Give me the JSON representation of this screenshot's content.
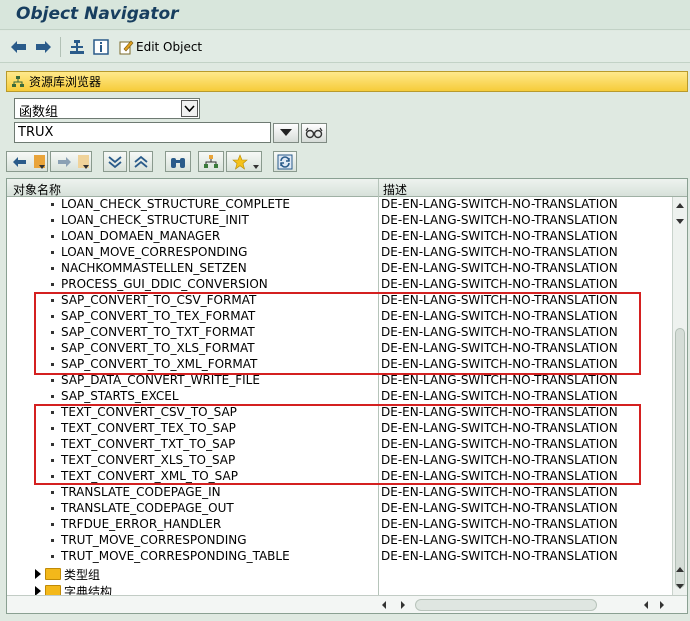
{
  "window": {
    "title": "Object Navigator"
  },
  "toolbar": {
    "edit_object_label": "Edit Object"
  },
  "repository_browser": {
    "panel_label": "资源库浏览器",
    "object_type_selected": "函数组",
    "object_name_value": "TRUX"
  },
  "tree": {
    "col_object_name": "对象名称",
    "col_description": "描述",
    "rows": [
      {
        "name": "LOAN_CHECK_STRUCTURE_COMPLETE",
        "desc": "DE-EN-LANG-SWITCH-NO-TRANSLATION"
      },
      {
        "name": "LOAN_CHECK_STRUCTURE_INIT",
        "desc": "DE-EN-LANG-SWITCH-NO-TRANSLATION"
      },
      {
        "name": "LOAN_DOMAEN_MANAGER",
        "desc": "DE-EN-LANG-SWITCH-NO-TRANSLATION"
      },
      {
        "name": "LOAN_MOVE_CORRESPONDING",
        "desc": "DE-EN-LANG-SWITCH-NO-TRANSLATION"
      },
      {
        "name": "NACHKOMMASTELLEN_SETZEN",
        "desc": "DE-EN-LANG-SWITCH-NO-TRANSLATION"
      },
      {
        "name": "PROCESS_GUI_DDIC_CONVERSION",
        "desc": "DE-EN-LANG-SWITCH-NO-TRANSLATION"
      },
      {
        "name": "SAP_CONVERT_TO_CSV_FORMAT",
        "desc": "DE-EN-LANG-SWITCH-NO-TRANSLATION"
      },
      {
        "name": "SAP_CONVERT_TO_TEX_FORMAT",
        "desc": "DE-EN-LANG-SWITCH-NO-TRANSLATION"
      },
      {
        "name": "SAP_CONVERT_TO_TXT_FORMAT",
        "desc": "DE-EN-LANG-SWITCH-NO-TRANSLATION"
      },
      {
        "name": "SAP_CONVERT_TO_XLS_FORMAT",
        "desc": "DE-EN-LANG-SWITCH-NO-TRANSLATION"
      },
      {
        "name": "SAP_CONVERT_TO_XML_FORMAT",
        "desc": "DE-EN-LANG-SWITCH-NO-TRANSLATION"
      },
      {
        "name": "SAP_DATA_CONVERT_WRITE_FILE",
        "desc": "DE-EN-LANG-SWITCH-NO-TRANSLATION"
      },
      {
        "name": "SAP_STARTS_EXCEL",
        "desc": "DE-EN-LANG-SWITCH-NO-TRANSLATION"
      },
      {
        "name": "TEXT_CONVERT_CSV_TO_SAP",
        "desc": "DE-EN-LANG-SWITCH-NO-TRANSLATION"
      },
      {
        "name": "TEXT_CONVERT_TEX_TO_SAP",
        "desc": "DE-EN-LANG-SWITCH-NO-TRANSLATION"
      },
      {
        "name": "TEXT_CONVERT_TXT_TO_SAP",
        "desc": "DE-EN-LANG-SWITCH-NO-TRANSLATION"
      },
      {
        "name": "TEXT_CONVERT_XLS_TO_SAP",
        "desc": "DE-EN-LANG-SWITCH-NO-TRANSLATION"
      },
      {
        "name": "TEXT_CONVERT_XML_TO_SAP",
        "desc": "DE-EN-LANG-SWITCH-NO-TRANSLATION"
      },
      {
        "name": "TRANSLATE_CODEPAGE_IN",
        "desc": "DE-EN-LANG-SWITCH-NO-TRANSLATION"
      },
      {
        "name": "TRANSLATE_CODEPAGE_OUT",
        "desc": "DE-EN-LANG-SWITCH-NO-TRANSLATION"
      },
      {
        "name": "TRFDUE_ERROR_HANDLER",
        "desc": "DE-EN-LANG-SWITCH-NO-TRANSLATION"
      },
      {
        "name": "TRUT_MOVE_CORRESPONDING",
        "desc": "DE-EN-LANG-SWITCH-NO-TRANSLATION"
      },
      {
        "name": "TRUT_MOVE_CORRESPONDING_TABLE",
        "desc": "DE-EN-LANG-SWITCH-NO-TRANSLATION"
      }
    ],
    "folders": [
      {
        "label": "类型组"
      },
      {
        "label": "字典结构"
      }
    ]
  },
  "colors": {
    "panel_header": "#f6cc3a",
    "highlight_border": "#d42020",
    "title_text": "#173e5f"
  },
  "icons": [
    "back-icon",
    "forward-icon",
    "hierarchy-icon",
    "info-icon",
    "edit-object-icon",
    "display-list-icon",
    "dropdown-icon",
    "glasses-icon",
    "previous-object-icon",
    "next-object-icon",
    "collapse-icon",
    "expand-icon",
    "find-icon",
    "tree-icon",
    "favorites-icon",
    "refresh-icon",
    "folder-icon"
  ]
}
